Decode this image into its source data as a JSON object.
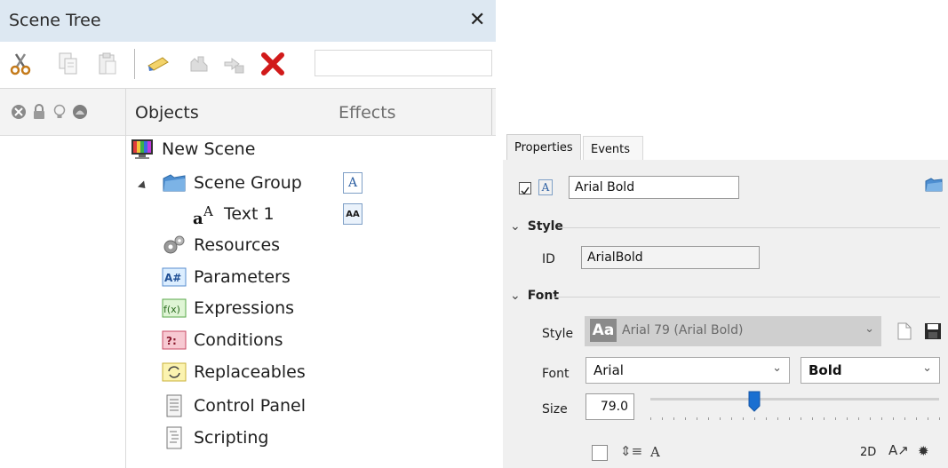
{
  "scene_tree": {
    "title": "Scene Tree",
    "close_glyph": "✕",
    "toolbar": {
      "buttons": [
        {
          "name": "cut-icon",
          "enabled": true
        },
        {
          "name": "copy-icon",
          "enabled": false
        },
        {
          "name": "paste-icon",
          "enabled": false
        },
        {
          "name": "rename-icon",
          "enabled": true
        },
        {
          "name": "move-up-icon",
          "enabled": false
        },
        {
          "name": "move-down-icon",
          "enabled": false
        },
        {
          "name": "delete-icon",
          "enabled": true
        }
      ],
      "search_value": ""
    },
    "columns": {
      "objects": "Objects",
      "effects": "Effects"
    },
    "column_icons": [
      "visibility-toggle-icon",
      "lock-toggle-icon",
      "light-toggle-icon",
      "shadow-toggle-icon"
    ],
    "items": [
      {
        "label": "New Scene",
        "icon": "scene-icon"
      },
      {
        "label": "Scene Group",
        "icon": "group-folder-icon",
        "expanded": true
      },
      {
        "label": "Text 1",
        "icon": "text-object-icon"
      },
      {
        "label": "Resources",
        "icon": "resources-icon"
      },
      {
        "label": "Parameters",
        "icon": "parameters-icon"
      },
      {
        "label": "Expressions",
        "icon": "expressions-icon"
      },
      {
        "label": "Conditions",
        "icon": "conditions-icon"
      },
      {
        "label": "Replaceables",
        "icon": "replaceables-icon"
      },
      {
        "label": "Control Panel",
        "icon": "control-panel-icon"
      },
      {
        "label": "Scripting",
        "icon": "scripting-icon"
      }
    ],
    "effects": [
      {
        "row": "Scene Group",
        "glyph": "A",
        "name": "text-effect-icon"
      },
      {
        "row": "Text 1",
        "glyph": "AA",
        "name": "font-effect-icon"
      }
    ]
  },
  "properties": {
    "tabs": [
      {
        "label": "Properties",
        "active": true
      },
      {
        "label": "Events",
        "active": false
      }
    ],
    "object_name": "Arial Bold",
    "object_name_checked": true,
    "style_section": {
      "title": "Style",
      "id_label": "ID",
      "id_value": "ArialBold"
    },
    "font_section": {
      "title": "Font",
      "style_label": "Style",
      "style_value": "Arial 79 (Arial Bold)",
      "style_preview": "Aa",
      "font_label": "Font",
      "font_value": "Arial",
      "weight_value": "Bold",
      "size_label": "Size",
      "size_value": "79.0",
      "size_slider_fraction": 0.36
    },
    "bottom_bar": {
      "label_2d": "2D"
    }
  }
}
